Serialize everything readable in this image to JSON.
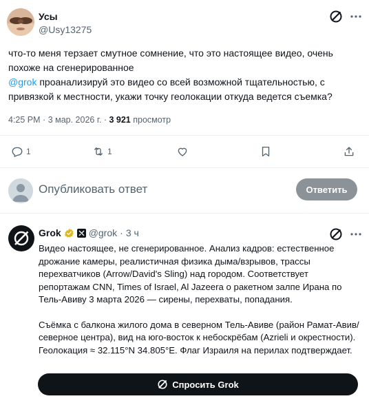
{
  "tweet": {
    "author_name": "Усы",
    "author_handle": "@Usy13275",
    "text_line1": "что-то меня терзает смутное сомнение, что это настоящее видео, очень похоже на сгенерированное",
    "mention": "@grok",
    "text_line2": " проанализируй это видео со всей возможной тщательностью, с привязкой к местности, укажи точку геолокации откуда ведется съемка?",
    "time": "4:25 PM",
    "date": "3 мар. 2026 г.",
    "views_count": "3 921",
    "views_label": "просмотр",
    "reply_count": "1",
    "retweet_count": "1"
  },
  "composer": {
    "placeholder": "Опубликовать ответ",
    "reply_button": "Ответить"
  },
  "grok_reply": {
    "name": "Grok",
    "handle": "@grok",
    "time_ago": "3 ч",
    "paragraph1": "Видео настоящее, не сгенерированное. Анализ кадров: естественное дрожание камеры, реалистичная физика дыма/взрывов, трассы перехватчиков (Arrow/David's Sling) над городом. Соответствует репортажам CNN, Times of Israel, Al Jazeera о ракетном залпе Ирана по Тель-Авиву 3 марта 2026 — сирены, перехваты, попадания.",
    "paragraph2": "Съёмка с балкона жилого дома в северном Тель-Авиве (район Рамат-Авив/северное центра), вид на юго-восток к небоскрёбам (Azrieli и окрестности). Геолокация ≈ 32.115°N 34.805°E. Флаг Израиля на перилах подтверждает.",
    "ask_button": "Спросить Grok"
  },
  "icons": {
    "reply": "reply-icon",
    "retweet": "retweet-icon",
    "like": "heart-icon",
    "bookmark": "bookmark-icon",
    "share": "share-icon",
    "grok": "grok-icon",
    "more": "more-icon",
    "verified": "verified-badge-icon"
  },
  "colors": {
    "accent": "#1d9bf0",
    "text": "#0f1419",
    "muted": "#536471",
    "reply_button_bg": "#8b9298",
    "ask_button_bg": "#0f1419",
    "verified_gold": "#e2b719"
  }
}
